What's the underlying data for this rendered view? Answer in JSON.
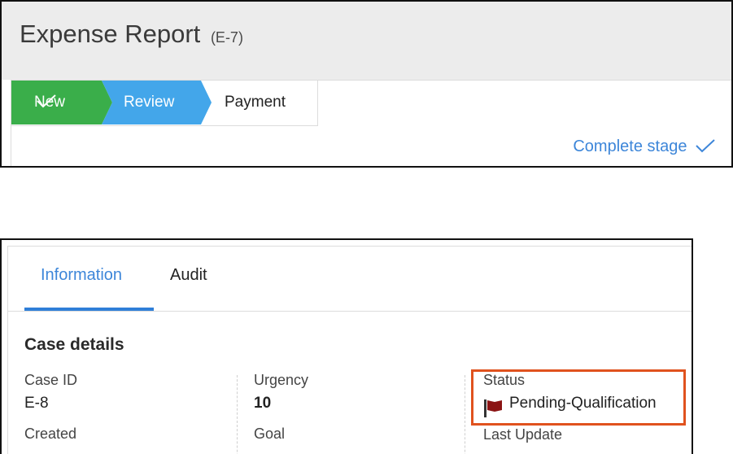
{
  "case": {
    "title": "Expense Report",
    "id": "(E-7)"
  },
  "stages": [
    {
      "label": "New",
      "state": "completed",
      "color": "#3aae4a"
    },
    {
      "label": "Review",
      "state": "current",
      "color": "#43a6ea"
    },
    {
      "label": "Payment",
      "state": "upcoming"
    }
  ],
  "complete_stage": {
    "label": "Complete stage",
    "icon": "check-icon",
    "color": "#3d86d9"
  },
  "tabs": [
    {
      "label": "Information",
      "active": true
    },
    {
      "label": "Audit",
      "active": false
    }
  ],
  "case_details": {
    "title": "Case details",
    "fields": {
      "case_id": {
        "label": "Case ID",
        "value": "E-8"
      },
      "urgency": {
        "label": "Urgency",
        "value": "10"
      },
      "status": {
        "label": "Status",
        "value": "Pending-Qualification",
        "icon": "flag-icon",
        "highlight_color": "#e0521e"
      },
      "created": {
        "label": "Created"
      },
      "goal": {
        "label": "Goal"
      },
      "last_update": {
        "label": "Last Update"
      }
    }
  }
}
